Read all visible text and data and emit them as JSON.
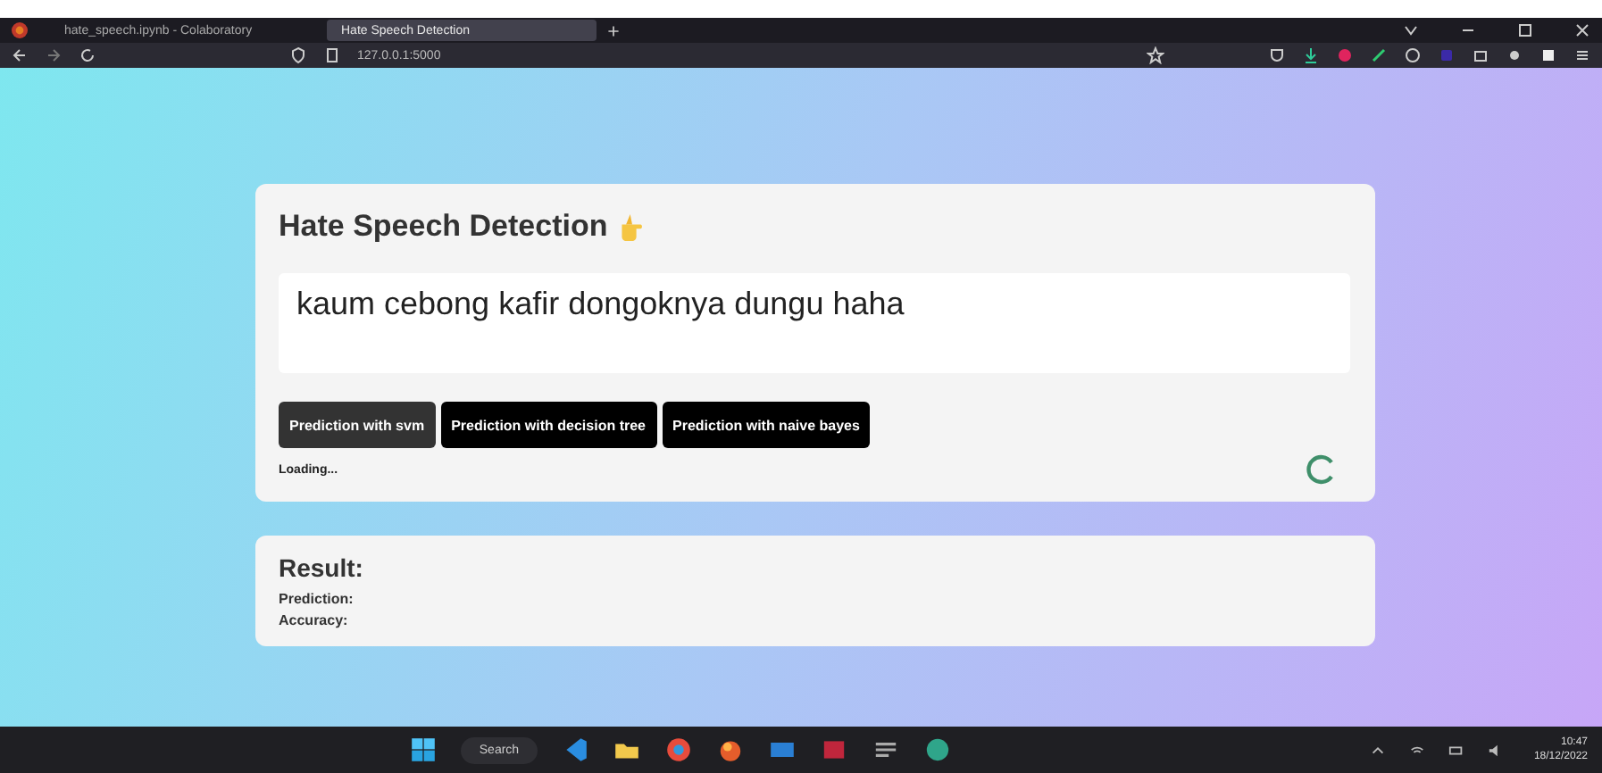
{
  "browser": {
    "tabs": [
      {
        "title": "hate_speech.ipynb - Colaboratory",
        "selected": false
      },
      {
        "title": "Hate Speech Detection",
        "selected": true
      }
    ],
    "address": "127.0.0.1:5000"
  },
  "detector": {
    "title": "Hate Speech Detection",
    "input": {
      "value": "kaum cebong kafir dongoknya dungu haha"
    },
    "buttons": [
      {
        "label": "Prediction with svm",
        "selected": true
      },
      {
        "label": "Prediction with decision tree",
        "selected": false
      },
      {
        "label": "Prediction with naive bayes",
        "selected": false
      }
    ],
    "status": "Loading...",
    "loading": true
  },
  "result": {
    "title": "Result:",
    "fields": [
      "Prediction:",
      "Accuracy:"
    ]
  },
  "taskbar": {
    "search": "Search",
    "time": "10:47",
    "date": "18/12/2022"
  }
}
